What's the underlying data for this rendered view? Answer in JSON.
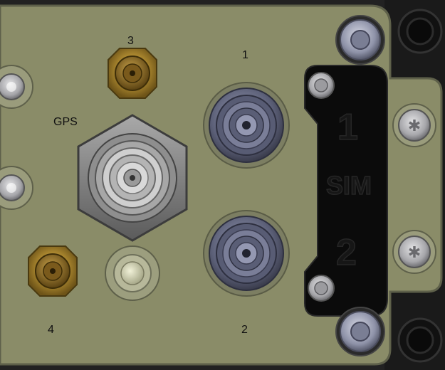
{
  "labels": {
    "port_3": "3",
    "port_1": "1",
    "port_gps": "GPS",
    "port_4": "4",
    "port_2": "2"
  },
  "sim_cover": {
    "slot_1": "1",
    "sim": "SIM",
    "slot_2": "2"
  },
  "colors": {
    "panel": "#8a8c68",
    "panel_edge": "#5e604a",
    "frame": "#1c1c1c",
    "sim_cover": "#0b0b0b",
    "sma_gold": "#a8852e",
    "tnc_gray": "#7d7d7d",
    "blue_connector": "#6a6e86",
    "screw": "#b9b9bd"
  }
}
